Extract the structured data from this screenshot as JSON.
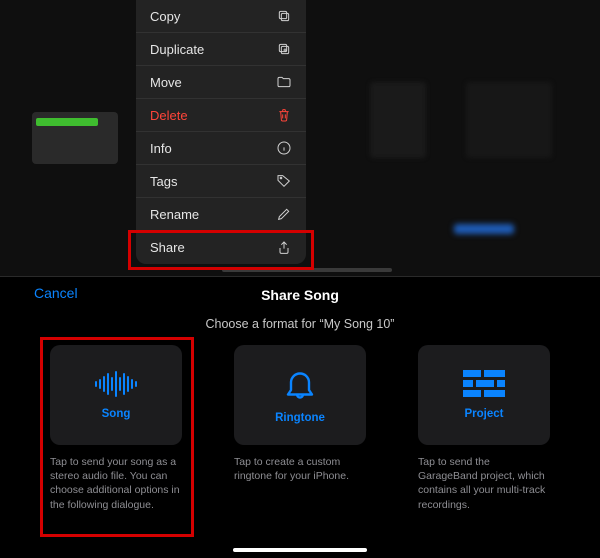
{
  "context_menu": {
    "items": [
      {
        "label": "Copy",
        "icon": "copy-icon",
        "danger": false
      },
      {
        "label": "Duplicate",
        "icon": "duplicate-icon",
        "danger": false
      },
      {
        "label": "Move",
        "icon": "folder-icon",
        "danger": false
      },
      {
        "label": "Delete",
        "icon": "trash-icon",
        "danger": true
      },
      {
        "label": "Info",
        "icon": "info-icon",
        "danger": false
      },
      {
        "label": "Tags",
        "icon": "tag-icon",
        "danger": false
      },
      {
        "label": "Rename",
        "icon": "pencil-icon",
        "danger": false
      },
      {
        "label": "Share",
        "icon": "share-icon",
        "danger": false
      }
    ]
  },
  "share_screen": {
    "cancel": "Cancel",
    "title": "Share Song",
    "prompt": "Choose a format for “My Song 10”",
    "options": [
      {
        "key": "song",
        "label": "Song",
        "icon": "waveform-icon",
        "desc": "Tap to send your song as a stereo audio file. You can choose additional options in the following dialogue."
      },
      {
        "key": "ringtone",
        "label": "Ringtone",
        "icon": "bell-icon",
        "desc": "Tap to create a custom ringtone for your iPhone."
      },
      {
        "key": "project",
        "label": "Project",
        "icon": "bricks-icon",
        "desc": "Tap to send the GarageBand project, which contains all your multi-track recordings."
      }
    ]
  },
  "colors": {
    "accent": "#0a84ff",
    "danger": "#ff453a",
    "highlight": "#d40000"
  }
}
